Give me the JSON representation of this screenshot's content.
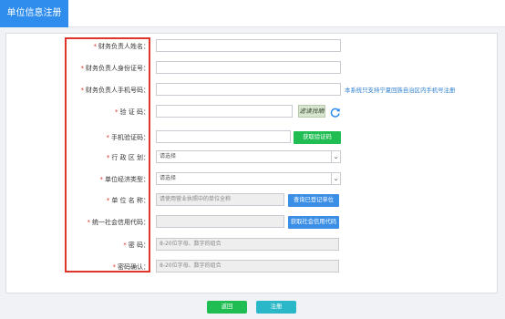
{
  "header": {
    "title": "单位信息注册"
  },
  "fields": {
    "finance_name": {
      "label": "财务负责人姓名：",
      "value": ""
    },
    "finance_id": {
      "label": "财务负责人身份证号：",
      "value": ""
    },
    "finance_phone": {
      "label": "财务负责人手机号码：",
      "value": "",
      "note": "本系统只支持宁夏回族自治区内手机号注册"
    },
    "captcha": {
      "label": "验 证 码：",
      "value": "",
      "image_text": "滤读找晒"
    },
    "sms_code": {
      "label": "手机验证码：",
      "value": "",
      "button": "获取验证码"
    },
    "region": {
      "label": "行 政 区 划：",
      "selected": "请选择"
    },
    "econ_type": {
      "label": "单位经济类型：",
      "selected": "请选择"
    },
    "unit_name": {
      "label": "单 位 名 称：",
      "placeholder": "请使用营业执照中的单位全称",
      "button": "查询已登记单位"
    },
    "credit_code": {
      "label": "统一社会信用代码：",
      "value": "",
      "button": "获取社会信用代码"
    },
    "password": {
      "label": "密 码：",
      "placeholder": "8-20位字母、数字的组合"
    },
    "password_confirm": {
      "label": "密码确认：",
      "placeholder": "8-20位字母、数字的组合"
    }
  },
  "required_mark": "*",
  "footer": {
    "back_label": "返回",
    "register_label": "注册"
  },
  "colors": {
    "header_blue": "#2e8ded",
    "green": "#1fbd52",
    "blue": "#3a8ee6",
    "required_red": "#e0352b"
  }
}
